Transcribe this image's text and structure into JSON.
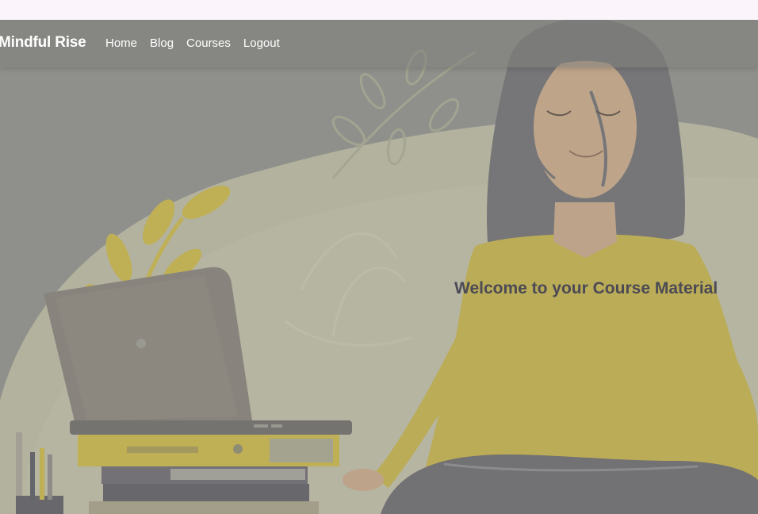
{
  "navbar": {
    "brand": "Mindful Rise",
    "links": [
      {
        "label": "Home"
      },
      {
        "label": "Blog"
      },
      {
        "label": "Courses"
      },
      {
        "label": "Logout"
      }
    ]
  },
  "hero": {
    "title": "Welcome to your Course Material",
    "illustration": "woman-meditating-laptop-books-plants"
  },
  "colors": {
    "page_bg": "#fbf5fb",
    "navbar": "#80807c",
    "hero_title": "#4b4a55",
    "mustard": "#c9b54a",
    "hair": "#6e6f74",
    "skin": "#c7a98a"
  }
}
